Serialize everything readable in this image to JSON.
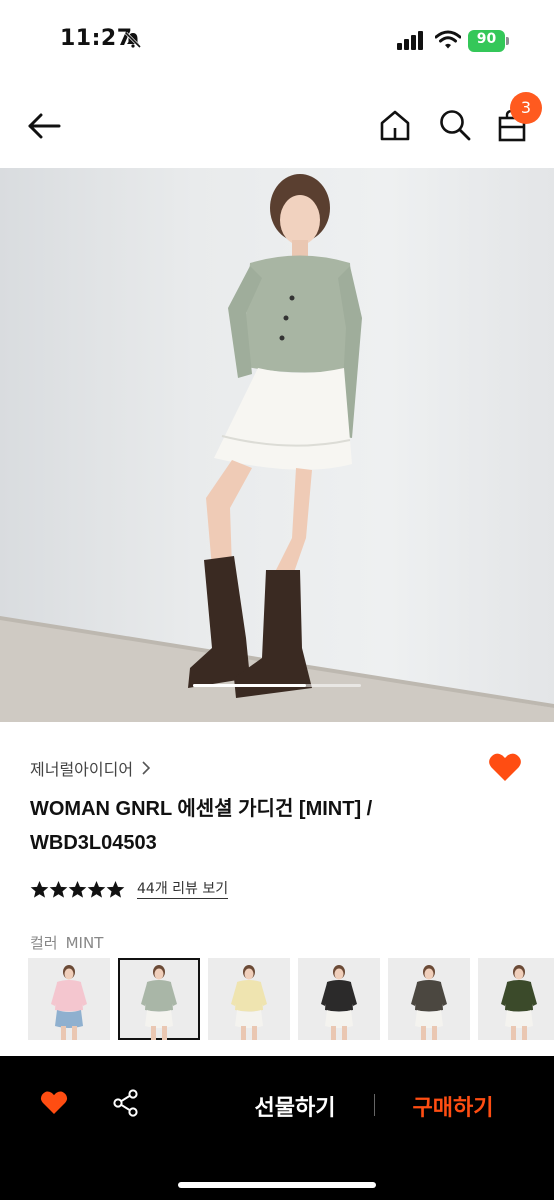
{
  "status_bar": {
    "time": "11:27",
    "battery": "90"
  },
  "nav": {
    "back_icon": "arrow-left-icon",
    "home_icon": "home-icon",
    "search_icon": "search-icon",
    "bag_icon": "shopping-bag-icon",
    "cart_count": "3"
  },
  "hero": {
    "slide_progress": 0.67
  },
  "product": {
    "brand": "제너럴아이디어",
    "title_line1": "WOMAN GNRL 에센셜 가디건 [MINT] /",
    "title_line2": "WBD3L04503",
    "rating_stars": 5,
    "review_link": "44개 리뷰 보기",
    "wishlisted": true
  },
  "color_option": {
    "label": "컬러",
    "selected": "MINT",
    "swatch_count": 6,
    "selected_index": 1,
    "swatch_colors": [
      "#f4c6cf",
      "#a9b6a7",
      "#efe4b0",
      "#2b2a2a",
      "#4b4740",
      "#3b4a2a"
    ]
  },
  "bottom_bar": {
    "gift_label": "선물하기",
    "buy_label": "구매하기"
  },
  "colors": {
    "accent": "#ff4d12",
    "badge": "#ff5a1f",
    "heart": "#ff4d12",
    "battery": "#34c759"
  }
}
